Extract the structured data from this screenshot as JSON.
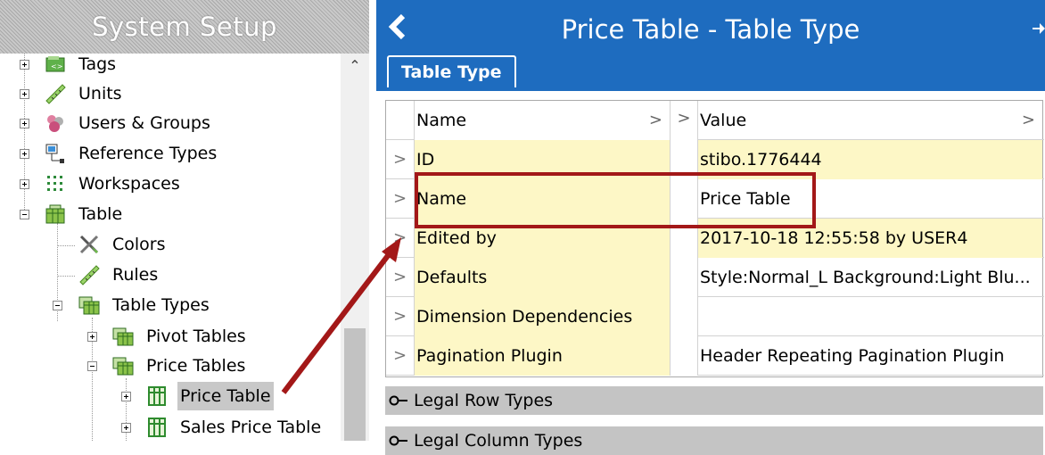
{
  "left_panel": {
    "title": "System Setup",
    "tree": [
      {
        "label": "Tags",
        "icon": "tags-icon"
      },
      {
        "label": "Units",
        "icon": "ruler-icon"
      },
      {
        "label": "Users & Groups",
        "icon": "users-icon"
      },
      {
        "label": "Reference Types",
        "icon": "reference-icon"
      },
      {
        "label": "Workspaces",
        "icon": "workspaces-icon"
      },
      {
        "label": "Table",
        "icon": "table-icon"
      },
      {
        "label": "Colors",
        "icon": "colors-tools-icon"
      },
      {
        "label": "Rules",
        "icon": "ruler-icon"
      },
      {
        "label": "Table Types",
        "icon": "table-types-icon"
      },
      {
        "label": "Pivot Tables",
        "icon": "table-types-icon"
      },
      {
        "label": "Price Tables",
        "icon": "table-types-icon"
      },
      {
        "label": "Price Table",
        "icon": "green-table-icon"
      },
      {
        "label": "Sales Price Table",
        "icon": "green-table-icon"
      }
    ]
  },
  "right_panel": {
    "title": "Price Table - Table Type",
    "tab": "Table Type",
    "grid": {
      "col_name": "Name",
      "col_value": "Value",
      "rows": [
        {
          "name": "ID",
          "value": "stibo.1776444"
        },
        {
          "name": "Name",
          "value": "Price Table"
        },
        {
          "name": "Edited by",
          "value": "2017-10-18 12:55:58 by USER4"
        },
        {
          "name": "Defaults",
          "value": "Style:Normal_L Background:Light Blu..."
        },
        {
          "name": "Dimension Dependencies",
          "value": ""
        },
        {
          "name": "Pagination Plugin",
          "value": "Header Repeating Pagination Plugin"
        }
      ]
    },
    "sections": [
      "Legal Row Types",
      "Legal Column Types"
    ]
  },
  "colors": {
    "accent": "#1e6cbf",
    "highlight": "#a31818",
    "field_yellow": "#fdf7c6"
  }
}
